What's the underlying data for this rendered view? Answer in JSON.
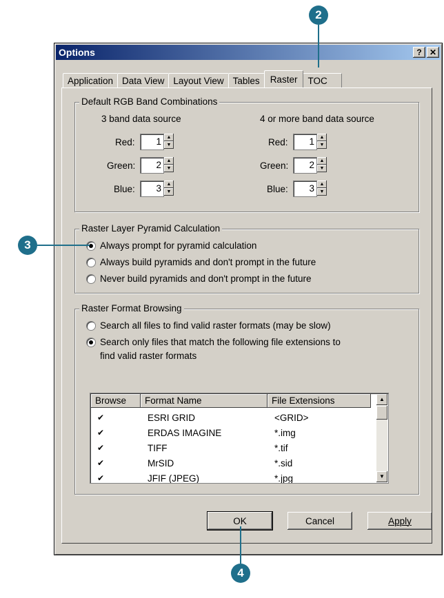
{
  "callouts": [
    "2",
    "3",
    "4"
  ],
  "dialog": {
    "title": "Options",
    "help_button": "?",
    "close_button": "✕",
    "tabs": [
      "Application",
      "Data View",
      "Layout View",
      "Tables",
      "Raster",
      "TOC"
    ],
    "active_tab": "Raster"
  },
  "rgb": {
    "legend": "Default RGB Band Combinations",
    "three_band": {
      "header": "3 band data source",
      "red_label": "Red:",
      "red": "1",
      "green_label": "Green:",
      "green": "2",
      "blue_label": "Blue:",
      "blue": "3"
    },
    "four_band": {
      "header": "4 or more band data source",
      "red_label": "Red:",
      "red": "1",
      "green_label": "Green:",
      "green": "2",
      "blue_label": "Blue:",
      "blue": "3"
    }
  },
  "pyramid": {
    "legend": "Raster Layer Pyramid Calculation",
    "options": [
      "Always prompt for pyramid calculation",
      "Always build pyramids and don't prompt in the future",
      "Never build pyramids and don't prompt in the future"
    ],
    "selected_index": 0
  },
  "browsing": {
    "legend": "Raster Format Browsing",
    "option1": "Search all files to find valid raster formats (may be slow)",
    "option2_line1": "Search only files that match the following file extensions to",
    "option2_line2": "find valid raster formats",
    "selected_index": 1,
    "columns": [
      "Browse",
      "Format Name",
      "File Extensions"
    ],
    "rows": [
      {
        "checked": "✔",
        "name": "ESRI GRID",
        "ext": "<GRID>"
      },
      {
        "checked": "✔",
        "name": "ERDAS IMAGINE",
        "ext": "*.img"
      },
      {
        "checked": "✔",
        "name": "TIFF",
        "ext": "*.tif"
      },
      {
        "checked": "✔",
        "name": "MrSID",
        "ext": "*.sid"
      },
      {
        "checked": "✔",
        "name": "JFIF (JPEG)",
        "ext": "*.jpg"
      }
    ]
  },
  "buttons": {
    "ok": "OK",
    "cancel": "Cancel",
    "apply": "Apply"
  },
  "colors": {
    "callout": "#1f6f8b",
    "titlebar_start": "#0a246a",
    "face": "#d4d0c8"
  }
}
